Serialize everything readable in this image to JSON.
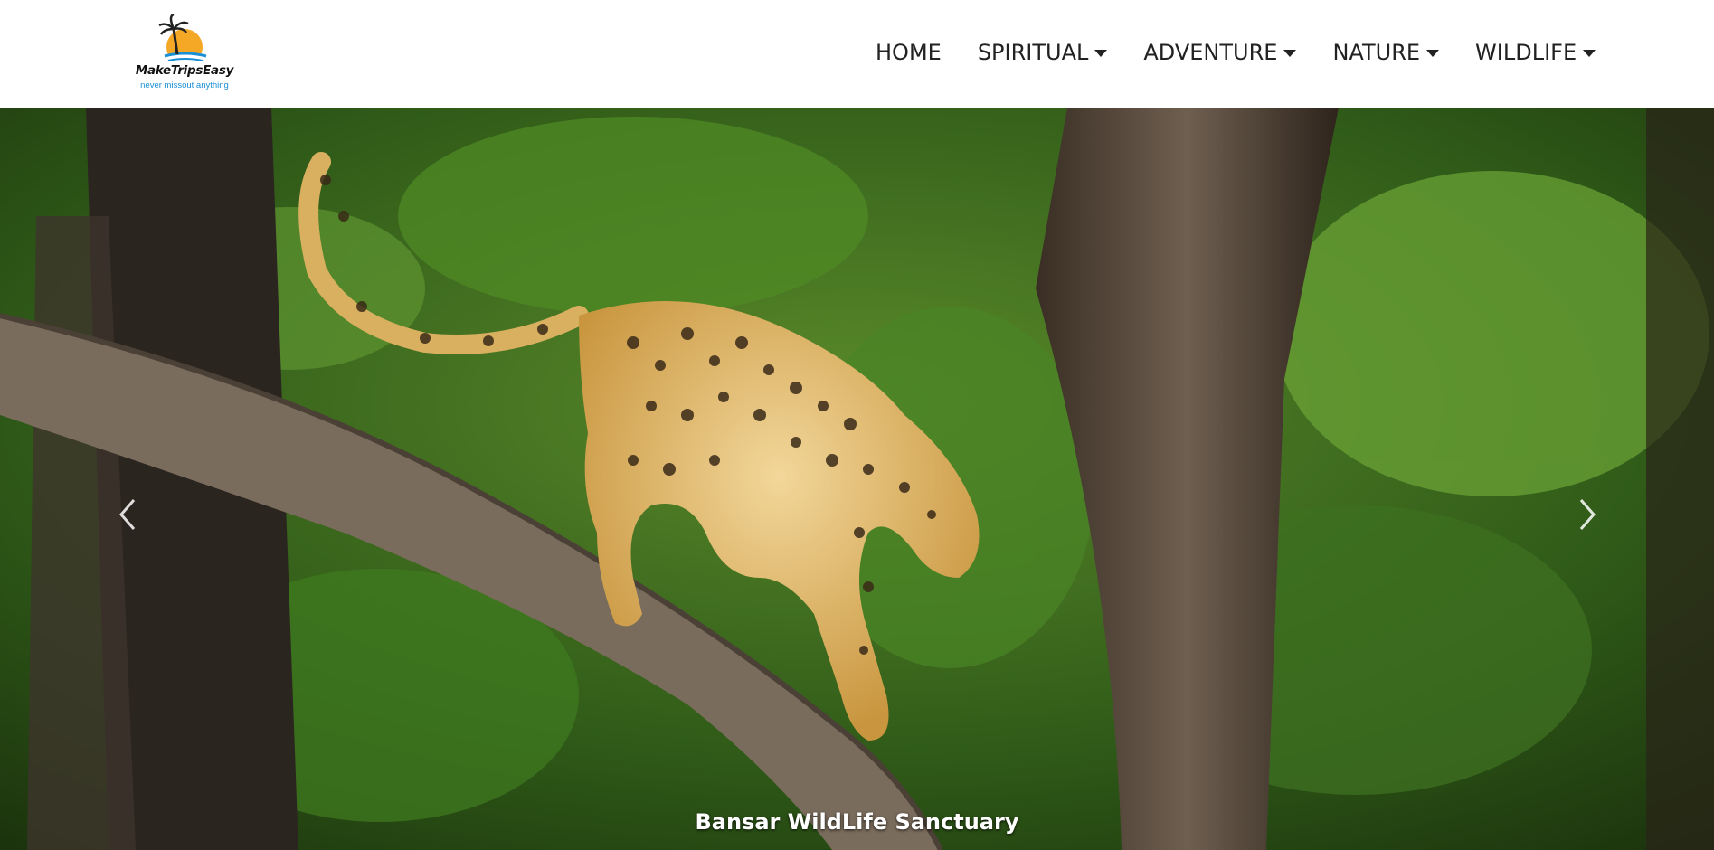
{
  "brand": {
    "name": "MakeTripsEasy",
    "tagline": "never missout anything"
  },
  "nav": {
    "home": "HOME",
    "spiritual": "SPIRITUAL",
    "adventure": "ADVENTURE",
    "nature": "NATURE",
    "wildlife": "WILDLIFE"
  },
  "carousel": {
    "caption": "Bansar WildLife Sanctuary",
    "prev_icon": "chevron-left-icon",
    "next_icon": "chevron-right-icon"
  },
  "colors": {
    "nav_text": "#222222",
    "tagline": "#1a8fd6",
    "logo_sun": "#f4a826"
  }
}
